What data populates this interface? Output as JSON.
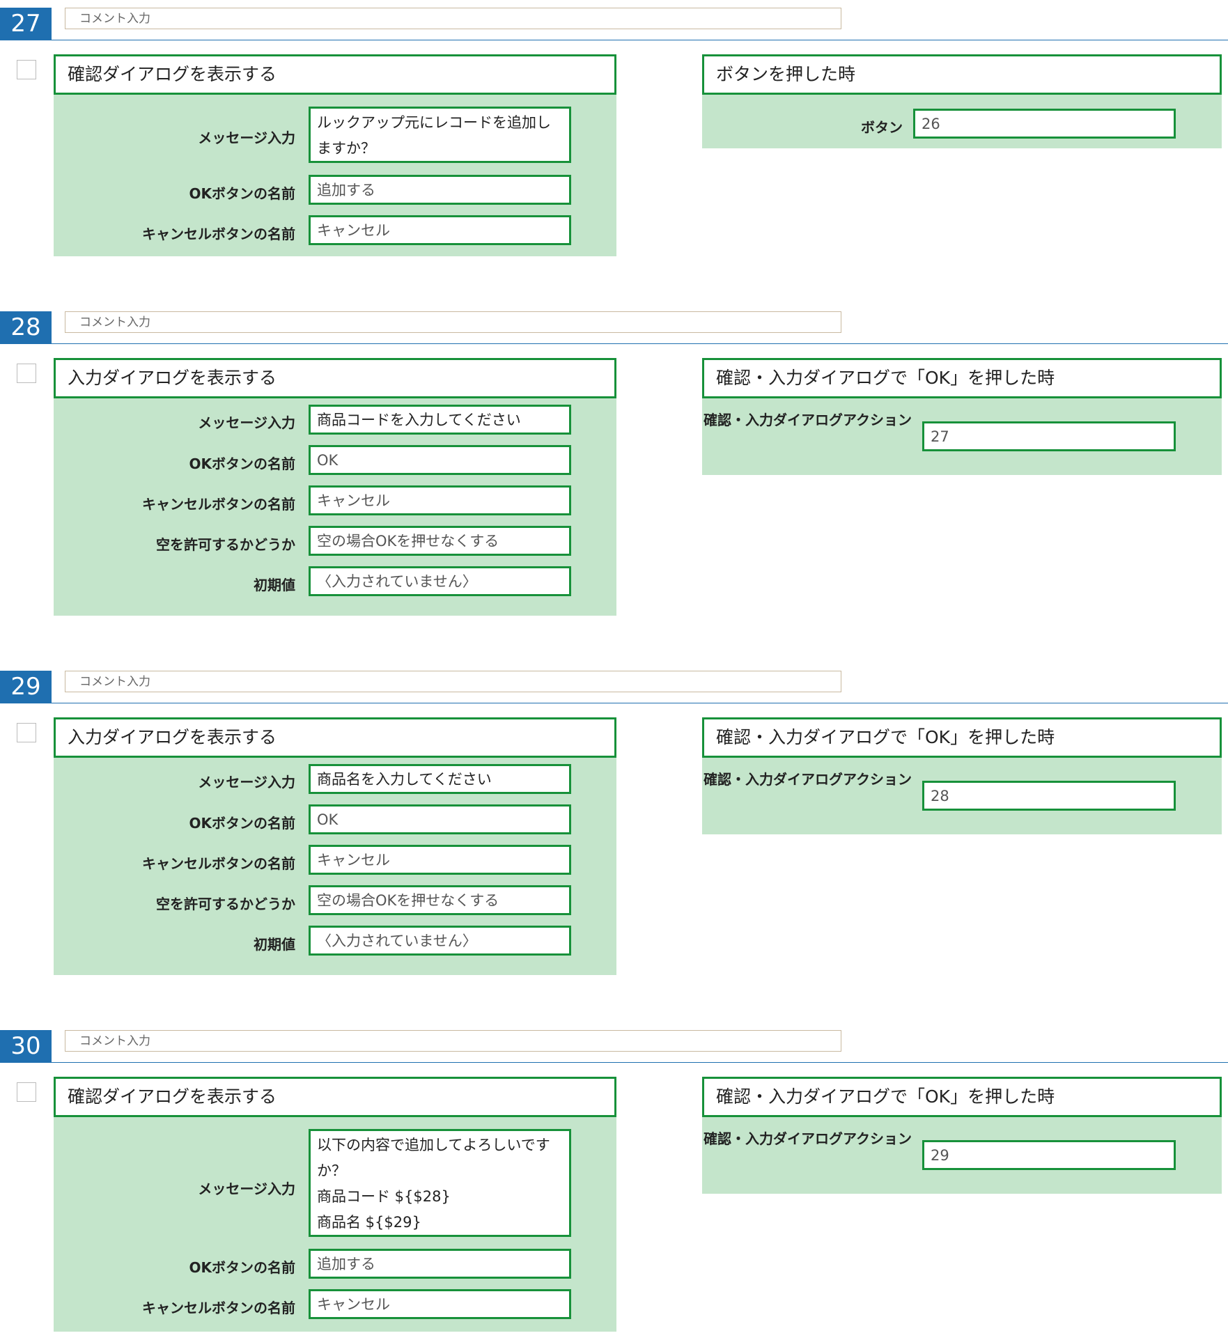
{
  "steps": [
    {
      "number": "27",
      "comment_placeholder": "コメント入力",
      "action": {
        "title": "確認ダイアログを表示する",
        "fields": [
          {
            "label": "メッセージ入力",
            "value": "ルックアップ元にレコードを追加しますか？"
          },
          {
            "label": "OKボタンの名前",
            "value": "追加する"
          },
          {
            "label": "キャンセルボタンの名前",
            "value": "キャンセル"
          }
        ]
      },
      "trigger": {
        "title": "ボタンを押した時",
        "label": "ボタン",
        "value": "26"
      }
    },
    {
      "number": "28",
      "comment_placeholder": "コメント入力",
      "action": {
        "title": "入力ダイアログを表示する",
        "fields": [
          {
            "label": "メッセージ入力",
            "value": "商品コードを入力してください"
          },
          {
            "label": "OKボタンの名前",
            "value": "OK"
          },
          {
            "label": "キャンセルボタンの名前",
            "value": "キャンセル"
          },
          {
            "label": "空を許可するかどうか",
            "value": "空の場合OKを押せなくする"
          },
          {
            "label": "初期値",
            "value": "〈入力されていません〉"
          }
        ]
      },
      "trigger": {
        "title": "確認・入力ダイアログで「OK」を押した時",
        "label": "確認・入力ダイアログアクション",
        "value": "27"
      }
    },
    {
      "number": "29",
      "comment_placeholder": "コメント入力",
      "action": {
        "title": "入力ダイアログを表示する",
        "fields": [
          {
            "label": "メッセージ入力",
            "value": "商品名を入力してください"
          },
          {
            "label": "OKボタンの名前",
            "value": "OK"
          },
          {
            "label": "キャンセルボタンの名前",
            "value": "キャンセル"
          },
          {
            "label": "空を許可するかどうか",
            "value": "空の場合OKを押せなくする"
          },
          {
            "label": "初期値",
            "value": "〈入力されていません〉"
          }
        ]
      },
      "trigger": {
        "title": "確認・入力ダイアログで「OK」を押した時",
        "label": "確認・入力ダイアログアクション",
        "value": "28"
      }
    },
    {
      "number": "30",
      "comment_placeholder": "コメント入力",
      "action": {
        "title": "確認ダイアログを表示する",
        "fields": [
          {
            "label": "メッセージ入力",
            "value": "以下の内容で追加してよろしいですか？\n商品コード ${$28}\n商品名 ${$29}"
          },
          {
            "label": "OKボタンの名前",
            "value": "追加する"
          },
          {
            "label": "キャンセルボタンの名前",
            "value": "キャンセル"
          }
        ]
      },
      "trigger": {
        "title": "確認・入力ダイアログで「OK」を押した時",
        "label": "確認・入力ダイアログアクション",
        "value": "29"
      }
    }
  ],
  "colors": {
    "accent_blue": "#1f6fb0",
    "card_green": "#c4e5cb",
    "border_green": "#17913a"
  }
}
